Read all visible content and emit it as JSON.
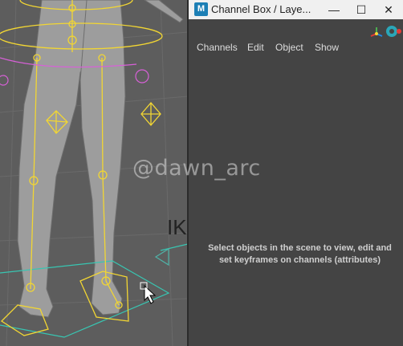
{
  "window": {
    "app_badge": "M",
    "title": "Channel Box / Laye...",
    "controls": {
      "minimize": "—",
      "maximize": "☐",
      "close": "✕"
    }
  },
  "menu": {
    "channels": "Channels",
    "edit": "Edit",
    "object": "Object",
    "show": "Show"
  },
  "toolbar": {
    "icons": [
      "axis-manipulator-icon",
      "channel-color-icon"
    ]
  },
  "message": {
    "empty_selection": "Select objects in the scene to view, edit and set keyframes on channels (attributes)"
  },
  "viewport": {
    "ik_label": "IK"
  },
  "watermark": "@dawn_arc",
  "colors": {
    "rig_yellow": "#f2d633",
    "control_magenta": "#d860d8",
    "ground_cyan": "#38c6b2",
    "titlebar": "#f0f0f0",
    "panel_bg": "#444444"
  }
}
